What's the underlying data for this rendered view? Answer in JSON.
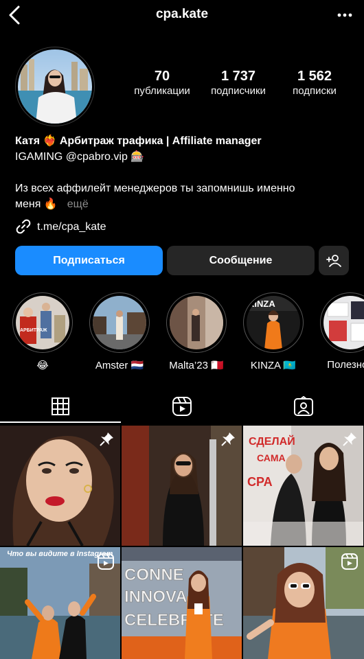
{
  "header": {
    "username": "cpa.kate",
    "back_icon": "chevron-left-icon",
    "more_icon": "ellipsis-icon"
  },
  "stats": [
    {
      "value": "70",
      "label": "публикации"
    },
    {
      "value": "1 737",
      "label": "подписчики"
    },
    {
      "value": "1 562",
      "label": "подписки"
    }
  ],
  "bio": {
    "name_line": "Катя ❤️‍🔥 Арбитраж трафика | Affiliate manager",
    "line2": "IGAMING @cpabro.vip 🎰",
    "line3": "Из всех аффилейт менеджеров ты запомнишь именно",
    "line4": "меня 🔥",
    "more": "ещё",
    "link": "t.me/cpa_kate"
  },
  "actions": {
    "follow": "Подписаться",
    "message": "Сообщение",
    "add_user_icon": "add-user-icon"
  },
  "highlights": [
    {
      "label": "😂"
    },
    {
      "label": "Amster 🇳🇱"
    },
    {
      "label": "Malta’23 🇲🇹"
    },
    {
      "label": "KINZA 🇰🇿"
    },
    {
      "label": "Полезное"
    }
  ],
  "highlight_texts": {
    "h1": "АРБИТРАЖ",
    "h4": "KINZA"
  },
  "tabs": [
    {
      "icon": "grid-icon",
      "active": true
    },
    {
      "icon": "reels-icon",
      "active": false
    },
    {
      "icon": "tagged-icon",
      "active": false
    }
  ],
  "posts": {
    "p3_text1": "СДЕЛАЙ",
    "p3_text2": "САМА",
    "p3_text3": "CPA",
    "p4_caption": "Что вы видите в Instagram",
    "p5_text1": "CONNE",
    "p5_text2": "INNOVA",
    "p5_text3": "CELEBRATE"
  },
  "colors": {
    "background": "#000000",
    "follow_button": "#1a8cff",
    "secondary_button": "#262626",
    "muted_text": "#8e8e8e"
  }
}
